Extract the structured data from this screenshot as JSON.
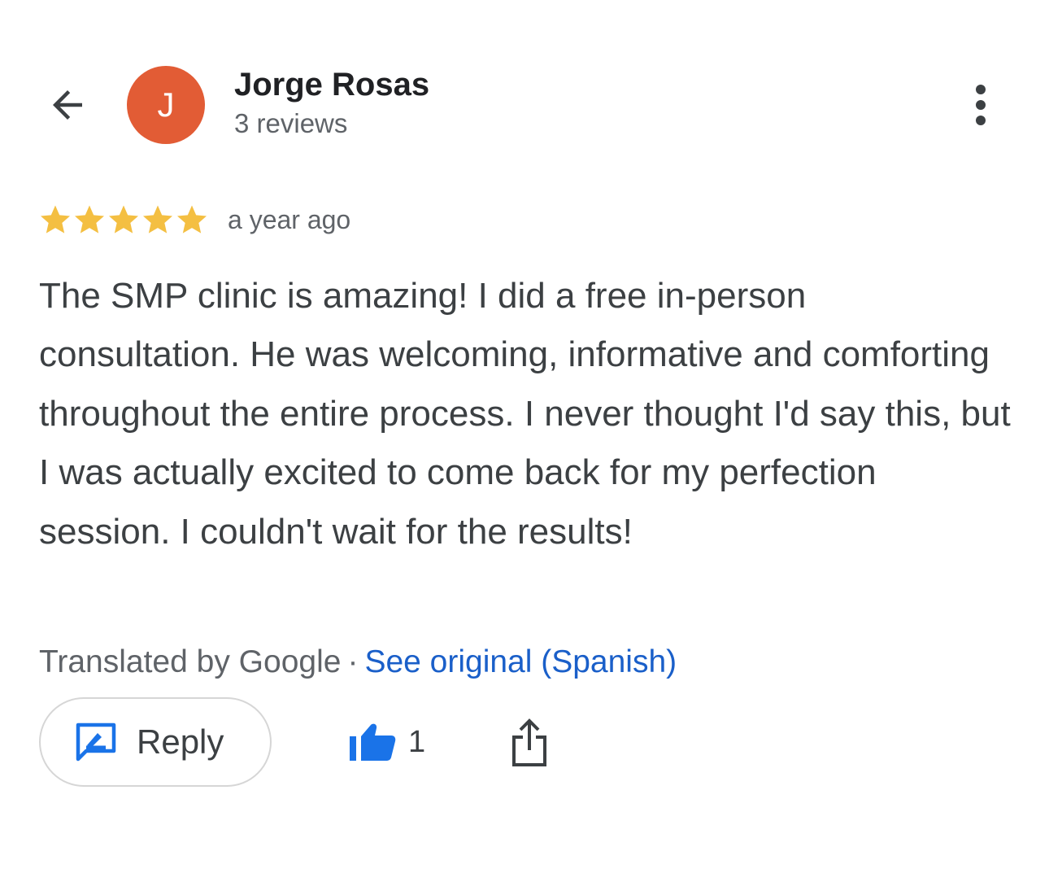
{
  "header": {
    "back_icon": "arrow-back-icon",
    "avatar_letter": "J",
    "avatar_color": "#e25c35",
    "reviewer_name": "Jorge Rosas",
    "reviews_count": "3 reviews",
    "more_icon": "more-vert-icon"
  },
  "review": {
    "rating": 5,
    "max_rating": 5,
    "star_color": "#f4bf42",
    "time_ago": "a year ago",
    "text": "The SMP clinic is amazing! I did a free in-person consultation. He was welcoming, informative and comforting throughout the entire process. I never thought I'd say this, but I was actually excited to come back for my perfection session. I couldn't wait for the results!"
  },
  "translation": {
    "translated_by": "Translated by Google",
    "separator": "·",
    "see_original": "See original (Spanish)",
    "link_color": "#1a5fc9"
  },
  "actions": {
    "reply_label": "Reply",
    "reply_icon": "rate-review-icon",
    "like_icon": "thumb-up-icon",
    "like_count": "1",
    "share_icon": "share-icon",
    "accent_color": "#1a73e8"
  }
}
